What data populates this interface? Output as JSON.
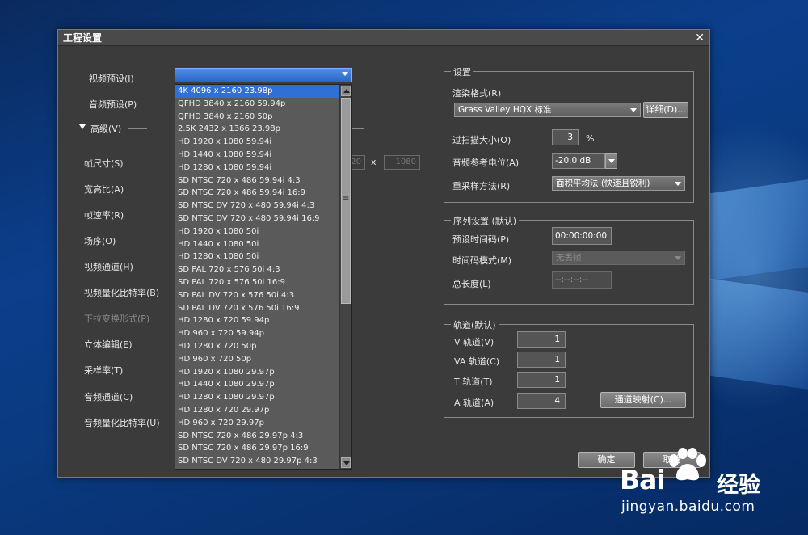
{
  "dialog": {
    "title": "工程设置",
    "close_glyph": "✕"
  },
  "left": {
    "video_preset_label": "视频预设(I)",
    "audio_preset_label": "音频预设(P)",
    "advanced_label": "高级(V)",
    "frame_size_label": "帧尺寸(S)",
    "aspect_label": "宽高比(A)",
    "frame_rate_label": "帧速率(R)",
    "field_order_label": "场序(O)",
    "video_channel_label": "视频通道(H)",
    "video_bits_label": "视频量化比特率(B)",
    "pulldown_label": "下拉变换形式(P)",
    "stereo_label": "立体编辑(E)",
    "sample_rate_label": "采样率(T)",
    "audio_channel_label": "音频通道(C)",
    "audio_bits_label": "音频量化比特率(U)",
    "frame_width_value": "20",
    "frame_x": "x",
    "frame_height_value": "1080"
  },
  "video_preset_list": {
    "items": [
      "4K 4096 x 2160 23.98p",
      "QFHD 3840 x 2160 59.94p",
      "QFHD 3840 x 2160 50p",
      "2.5K 2432 x 1366 23.98p",
      "HD 1920 x 1080 59.94i",
      "HD 1440 x 1080 59.94i",
      "HD 1280 x 1080 59.94i",
      "SD NTSC 720 x 486 59.94i 4:3",
      "SD NTSC 720 x 486 59.94i 16:9",
      "SD NTSC DV 720 x 480 59.94i 4:3",
      "SD NTSC DV 720 x 480 59.94i 16:9",
      "HD 1920 x 1080 50i",
      "HD 1440 x 1080 50i",
      "HD 1280 x 1080 50i",
      "SD PAL 720 x 576 50i 4:3",
      "SD PAL 720 x 576 50i 16:9",
      "SD PAL DV 720 x 576 50i 4:3",
      "SD PAL DV 720 x 576 50i 16:9",
      "HD 1280 x 720 59.94p",
      "HD 960 x 720 59.94p",
      "HD 1280 x 720 50p",
      "HD 960 x 720 50p",
      "HD 1920 x 1080 29.97p",
      "HD 1440 x 1080 29.97p",
      "HD 1280 x 1080 29.97p",
      "HD 1280 x 720 29.97p",
      "HD 960 x 720 29.97p",
      "SD NTSC 720 x 486 29.97p 4:3",
      "SD NTSC 720 x 486 29.97p 16:9",
      "SD NTSC DV 720 x 480 29.97p 4:3"
    ]
  },
  "settings": {
    "group_title": "设置",
    "render_format_label": "渲染格式(R)",
    "render_format_value": "Grass Valley HQX 标准",
    "detail_button": "详细(D)...",
    "overscan_label": "过扫描大小(O)",
    "overscan_value": "3",
    "overscan_unit": "%",
    "audio_ref_label": "音频参考电位(A)",
    "audio_ref_value": "-20.0 dB",
    "resample_label": "重采样方法(R)",
    "resample_value": "面积平均法 (快速且锐利)"
  },
  "sequence": {
    "group_title": "序列设置 (默认)",
    "preset_tc_label": "预设时间码(P)",
    "preset_tc_value": "00:00:00:00",
    "tc_mode_label": "时间码模式(M)",
    "tc_mode_value": "无丢帧",
    "total_length_label": "总长度(L)",
    "total_length_value": "--:--:--:--"
  },
  "tracks": {
    "group_title": "轨道(默认)",
    "v_label": "V 轨道(V)",
    "v_value": "1",
    "va_label": "VA 轨道(C)",
    "va_value": "1",
    "t_label": "T 轨道(T)",
    "t_value": "1",
    "a_label": "A 轨道(A)",
    "a_value": "4",
    "channel_map_button": "通道映射(C)..."
  },
  "footer": {
    "ok_button": "确定",
    "cancel_button": "取消"
  },
  "watermark": {
    "brand_left": "Bai",
    "brand_right": "经验",
    "url": "jingyan.baidu.com"
  }
}
